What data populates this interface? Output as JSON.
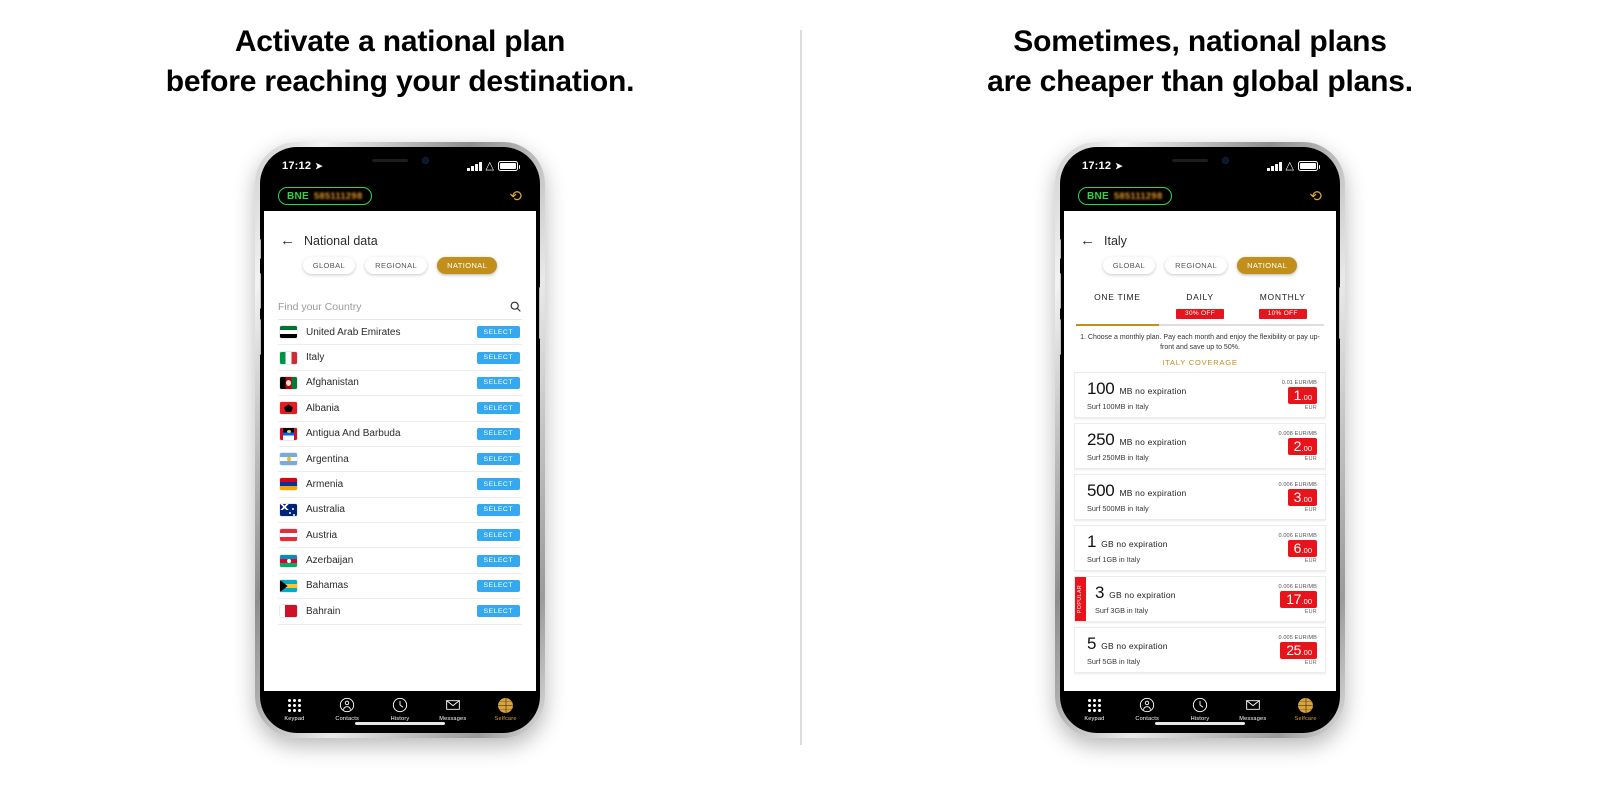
{
  "left": {
    "headline": [
      "Activate a national plan",
      "before reaching your destination."
    ],
    "status": {
      "time": "17:12"
    },
    "appbar": {
      "carrier_label": "BNE",
      "number": "585111298",
      "refresh_icon": "refresh-icon"
    },
    "nav": {
      "back_icon": "back-arrow-icon",
      "title": "National data"
    },
    "chips": [
      {
        "label": "GLOBAL",
        "active": false
      },
      {
        "label": "REGIONAL",
        "active": false
      },
      {
        "label": "NATIONAL",
        "active": true
      }
    ],
    "search": {
      "placeholder": "Find your Country",
      "icon": "search-icon"
    },
    "select_label": "SELECT",
    "countries": [
      {
        "name": "United Arab Emirates",
        "flag": "ae"
      },
      {
        "name": "Italy",
        "flag": "it"
      },
      {
        "name": "Afghanistan",
        "flag": "af"
      },
      {
        "name": "Albania",
        "flag": "al"
      },
      {
        "name": "Antigua And Barbuda",
        "flag": "ag"
      },
      {
        "name": "Argentina",
        "flag": "ar"
      },
      {
        "name": "Armenia",
        "flag": "am"
      },
      {
        "name": "Australia",
        "flag": "au"
      },
      {
        "name": "Austria",
        "flag": "at"
      },
      {
        "name": "Azerbaijan",
        "flag": "az"
      },
      {
        "name": "Bahamas",
        "flag": "bs"
      },
      {
        "name": "Bahrain",
        "flag": "bh"
      }
    ]
  },
  "right": {
    "headline": [
      "Sometimes, national plans",
      "are cheaper than global plans."
    ],
    "status": {
      "time": "17:12"
    },
    "appbar": {
      "carrier_label": "BNE",
      "number": "585111298",
      "refresh_icon": "refresh-icon"
    },
    "nav": {
      "back_icon": "back-arrow-icon",
      "title": "Italy"
    },
    "chips": [
      {
        "label": "GLOBAL",
        "active": false
      },
      {
        "label": "REGIONAL",
        "active": false
      },
      {
        "label": "NATIONAL",
        "active": true
      }
    ],
    "plan_tabs": [
      {
        "label": "ONE TIME",
        "badge": "",
        "active": true
      },
      {
        "label": "DAILY",
        "badge": "30% OFF",
        "active": false
      },
      {
        "label": "MONTHLY",
        "badge": "10% OFF",
        "active": false
      }
    ],
    "note": "1. Choose a monthly plan. Pay each month and enjoy the flexibility or pay up-front and save up to 50%.",
    "coverage_title": "ITALY COVERAGE",
    "currency": "EUR",
    "plans": [
      {
        "amount": "100",
        "unit": "MB no expiration",
        "sub": "Surf 100MB in Italy",
        "rate": "0.01 EUR/MB",
        "price_int": "1",
        "price_dec": ".00",
        "popular": false
      },
      {
        "amount": "250",
        "unit": "MB no expiration",
        "sub": "Surf 250MB in Italy",
        "rate": "0.008 EUR/MB",
        "price_int": "2",
        "price_dec": ".00",
        "popular": false
      },
      {
        "amount": "500",
        "unit": "MB no expiration",
        "sub": "Surf 500MB in Italy",
        "rate": "0.006 EUR/MB",
        "price_int": "3",
        "price_dec": ".00",
        "popular": false
      },
      {
        "amount": "1",
        "unit": "GB no expiration",
        "sub": "Surf 1GB in Italy",
        "rate": "0.006 EUR/MB",
        "price_int": "6",
        "price_dec": ".00",
        "popular": false
      },
      {
        "amount": "3",
        "unit": "GB no expiration",
        "sub": "Surf 3GB in Italy",
        "rate": "0.006 EUR/MB",
        "price_int": "17",
        "price_dec": ".00",
        "popular": true,
        "popular_label": "POPULAR"
      },
      {
        "amount": "5",
        "unit": "GB no expiration",
        "sub": "Surf 5GB in Italy",
        "rate": "0.005 EUR/MB",
        "price_int": "25",
        "price_dec": ".00",
        "popular": false
      }
    ]
  },
  "tabbar": [
    {
      "label": "Keypad",
      "icon": "keypad-icon",
      "active": false
    },
    {
      "label": "Contacts",
      "icon": "contacts-icon",
      "active": false
    },
    {
      "label": "History",
      "icon": "history-icon",
      "active": false
    },
    {
      "label": "Messages",
      "icon": "messages-icon",
      "active": false
    },
    {
      "label": "Selfcare",
      "icon": "globe-icon",
      "active": true
    }
  ],
  "colors": {
    "accent_gold": "#c28f1b",
    "select_blue": "#35a9f0",
    "price_red": "#e8141c",
    "carrier_green": "#2bd64a"
  }
}
